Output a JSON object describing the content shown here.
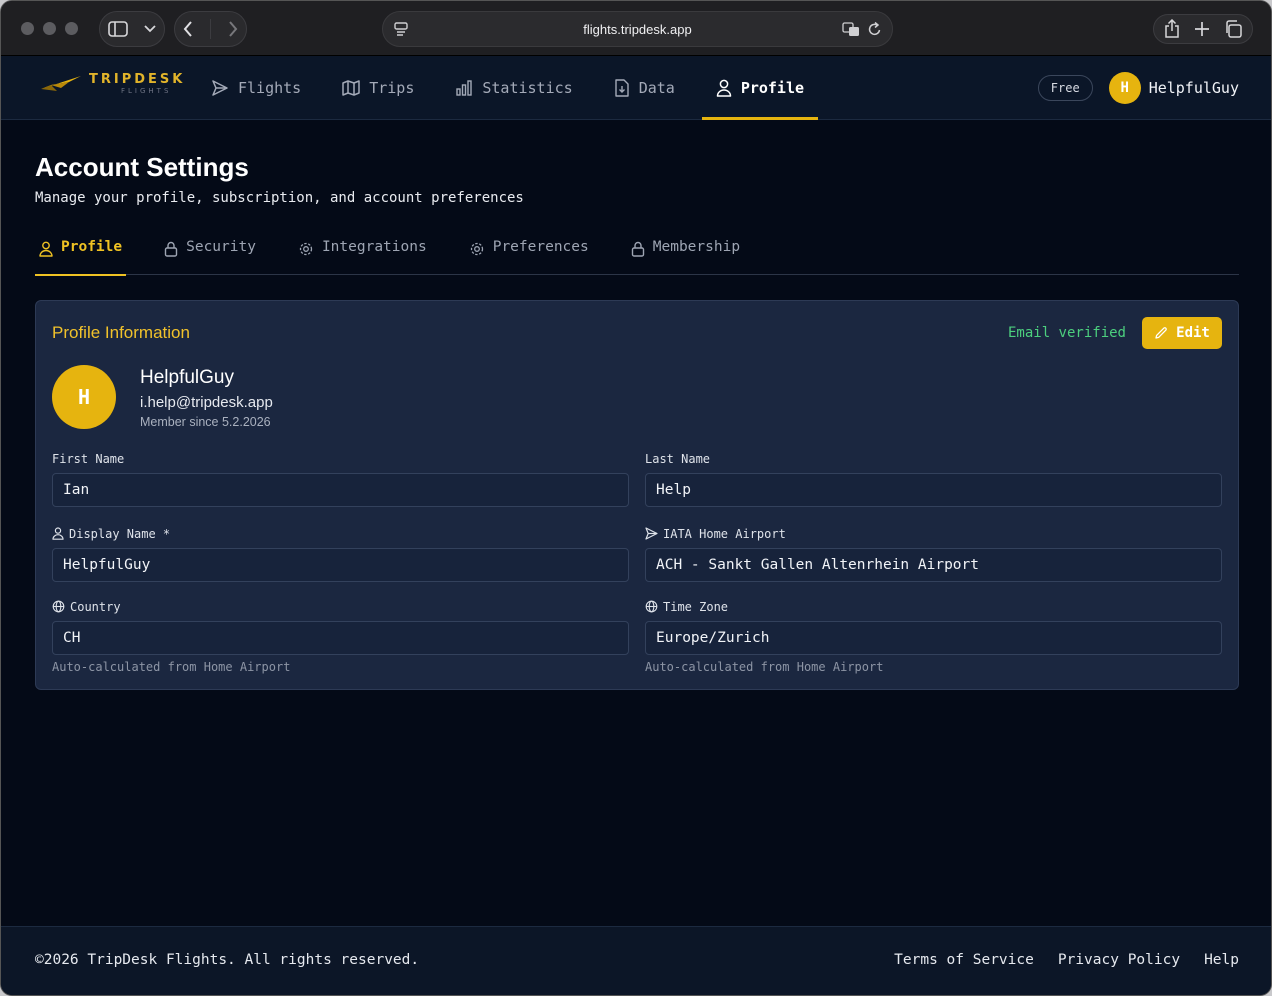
{
  "browser": {
    "url": "flights.tripdesk.app"
  },
  "app": {
    "logo_main": "TRIPDESK",
    "logo_sub": "FLIGHTS",
    "nav": [
      {
        "label": "Flights",
        "icon": "paper-plane-icon"
      },
      {
        "label": "Trips",
        "icon": "map-icon"
      },
      {
        "label": "Statistics",
        "icon": "bar-chart-icon"
      },
      {
        "label": "Data",
        "icon": "file-download-icon"
      },
      {
        "label": "Profile",
        "icon": "user-icon",
        "active": true
      }
    ],
    "plan": "Free",
    "user_initial": "H",
    "username": "HelpfulGuy"
  },
  "page": {
    "title": "Account Settings",
    "subtitle": "Manage your profile, subscription, and account preferences",
    "tabs": [
      {
        "label": "Profile",
        "icon": "user-icon",
        "active": true
      },
      {
        "label": "Security",
        "icon": "lock-icon"
      },
      {
        "label": "Integrations",
        "icon": "gear-icon"
      },
      {
        "label": "Preferences",
        "icon": "gear-icon"
      },
      {
        "label": "Membership",
        "icon": "lock-icon"
      }
    ]
  },
  "profile_card": {
    "title": "Profile Information",
    "verified": "Email verified",
    "edit_label": "Edit",
    "avatar_initial": "H",
    "name": "HelpfulGuy",
    "email": "i.help@tripdesk.app",
    "member_since": "Member since 5.2.2026",
    "fields": {
      "first_name": {
        "label": "First Name",
        "value": "Ian"
      },
      "last_name": {
        "label": "Last Name",
        "value": "Help"
      },
      "display_name": {
        "label": "Display Name *",
        "value": "HelpfulGuy"
      },
      "home_airport": {
        "label": "IATA Home Airport",
        "value": "ACH - Sankt Gallen Altenrhein Airport"
      },
      "country": {
        "label": "Country",
        "value": "CH",
        "hint": "Auto-calculated from Home Airport"
      },
      "time_zone": {
        "label": "Time Zone",
        "value": "Europe/Zurich",
        "hint": "Auto-calculated from Home Airport"
      }
    }
  },
  "footer": {
    "copyright": "©2026 TripDesk Flights. All rights reserved.",
    "links": [
      "Terms of Service",
      "Privacy Policy",
      "Help"
    ]
  },
  "colors": {
    "accent": "#e6b40f",
    "background": "#040a17",
    "card": "#1b2740",
    "verified": "#4ccf7e"
  }
}
